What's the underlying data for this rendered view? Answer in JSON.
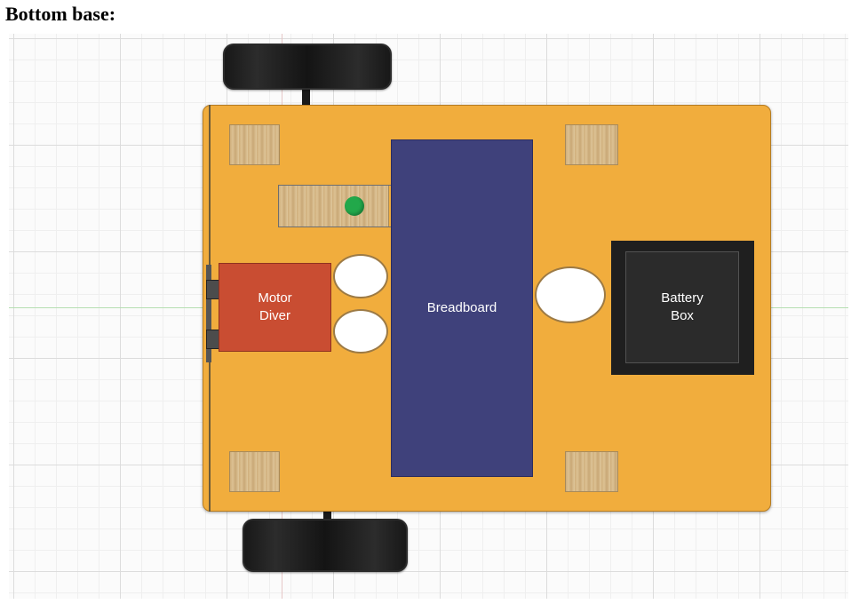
{
  "page": {
    "heading": "Bottom base:"
  },
  "components": {
    "breadboard": {
      "label": "Breadboard"
    },
    "motor_driver": {
      "line1": "Motor",
      "line2": "Diver"
    },
    "battery_box": {
      "line1": "Battery",
      "line2": "Box"
    }
  },
  "colors": {
    "base": "#f1ad3d",
    "breadboard": "#3f417b",
    "motor_driver": "#c94d32",
    "battery_box": "#1f1f1f",
    "wheels": "#111111",
    "switch_led": "#22a84a",
    "wood_spacer": "#d7b98a"
  }
}
